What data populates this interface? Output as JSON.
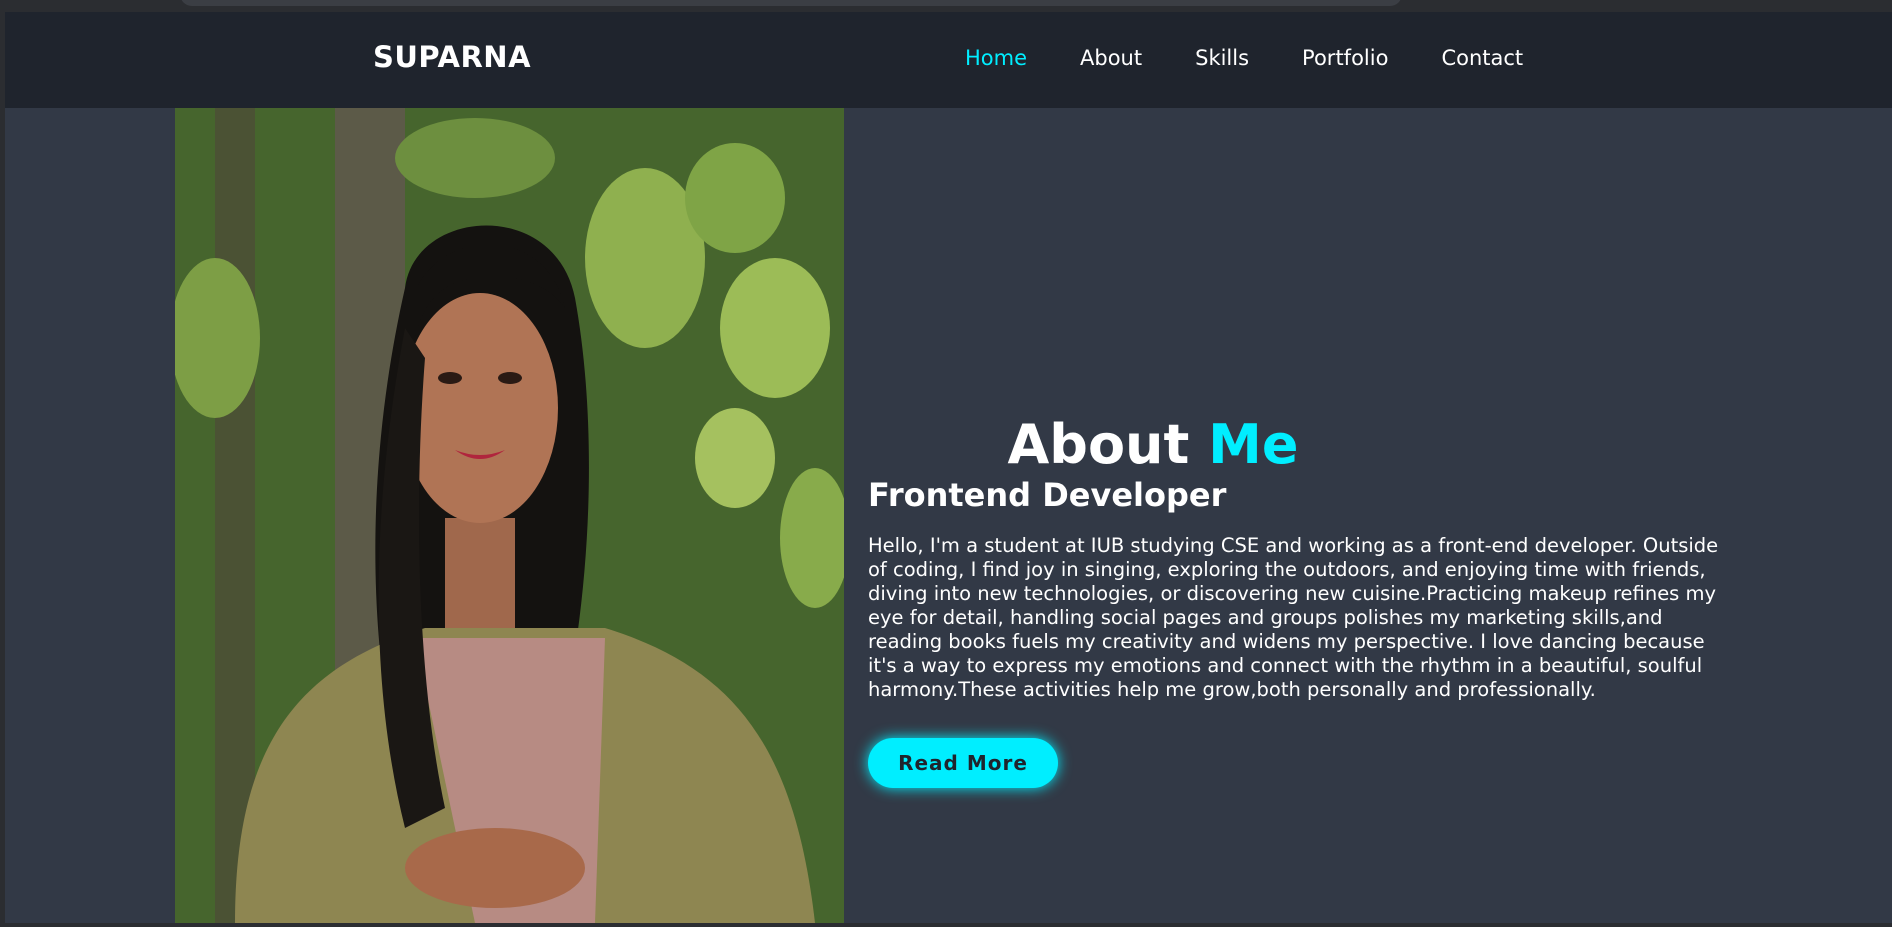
{
  "header": {
    "logo": "SUPARNA",
    "nav": [
      {
        "label": "Home",
        "active": true
      },
      {
        "label": "About",
        "active": false
      },
      {
        "label": "Skills",
        "active": false
      },
      {
        "label": "Portfolio",
        "active": false
      },
      {
        "label": "Contact",
        "active": false
      }
    ]
  },
  "about": {
    "title_main": "About",
    "title_accent": "Me",
    "subtitle": "Frontend Developer",
    "bio": "Hello, I'm a student at IUB studying CSE and working as a front-end developer. Outside of coding, I find joy in singing, exploring the outdoors, and enjoying time with friends, diving into new technologies, or discovering new cuisine.Practicing makeup refines my eye for detail, handling social pages and groups polishes my marketing skills,and reading books fuels my creativity and widens my perspective. I love dancing because it's a way to express my emotions and connect with the rhythm in a beautiful, soulful harmony.These activities help me grow,both personally and professionally.",
    "button_label": "Read More"
  },
  "colors": {
    "accent": "#00eeff",
    "nav_bg": "#1f242d",
    "page_bg": "#323946",
    "text": "#ffffff"
  }
}
